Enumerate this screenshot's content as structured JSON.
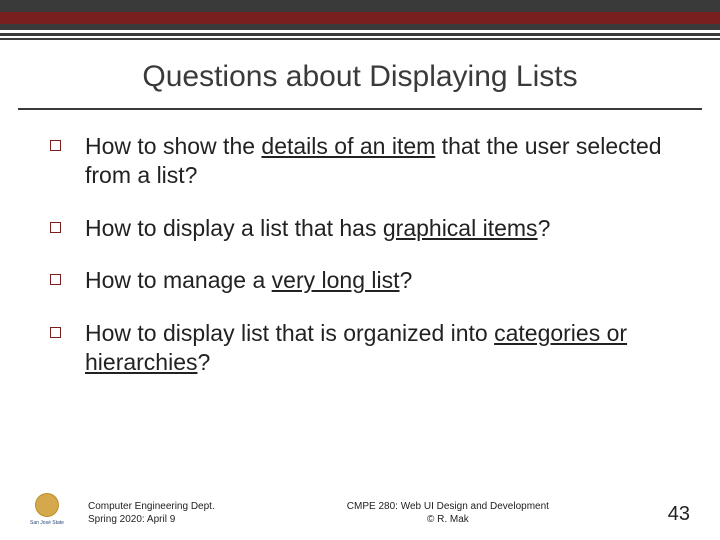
{
  "title": "Questions about Displaying Lists",
  "bullets": [
    {
      "pre": "How to show the ",
      "u": "details of an item",
      "post": " that the user selected from a list?"
    },
    {
      "pre": "How to display a list that has ",
      "u": "graphical items",
      "post": "?"
    },
    {
      "pre": "How to manage a ",
      "u": "very long list",
      "post": "?"
    },
    {
      "pre": "How to display list that is organized into ",
      "u": "categories or hierarchies",
      "post": "?"
    }
  ],
  "footer": {
    "left_line1": "Computer Engineering Dept.",
    "left_line2": "Spring 2020: April 9",
    "center_line1": "CMPE 280: Web UI Design and Development",
    "center_line2": "© R. Mak",
    "page": "43",
    "logo_text": "San José State"
  }
}
